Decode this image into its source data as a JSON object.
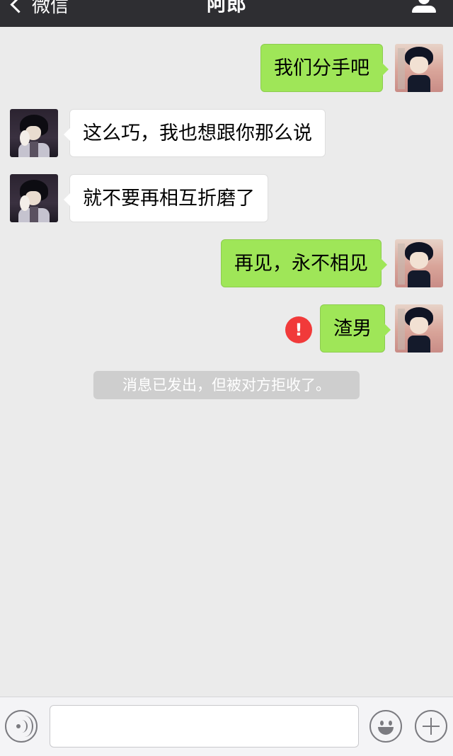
{
  "nav": {
    "back_label": "微信",
    "title": "阿郎",
    "profile_icon": "person-icon"
  },
  "messages": [
    {
      "direction": "sent",
      "text": "我们分手吧",
      "avatar": "girl-avatar"
    },
    {
      "direction": "received",
      "text": "这么巧，我也想跟你那么说",
      "avatar": "boy-avatar"
    },
    {
      "direction": "received",
      "text": "就不要再相互折磨了",
      "avatar": "boy-avatar"
    },
    {
      "direction": "sent",
      "text": "再见，永不相见",
      "avatar": "girl-avatar"
    },
    {
      "direction": "sent",
      "text": "渣男",
      "avatar": "girl-avatar",
      "status": "failed",
      "status_icon_glyph": "!"
    }
  ],
  "system_notice": "消息已发出，但被对方拒收了。",
  "input_bar": {
    "voice_icon": "voice-icon",
    "text_value": "",
    "emoji_icon": "emoji-icon",
    "plus_icon": "plus-icon"
  },
  "colors": {
    "nav_bg": "#2e2e32",
    "chat_bg": "#ebebeb",
    "sent_bubble": "#9fe658",
    "received_bubble": "#ffffff",
    "error_red": "#f13a3a",
    "notice_bg": "#cecece"
  }
}
